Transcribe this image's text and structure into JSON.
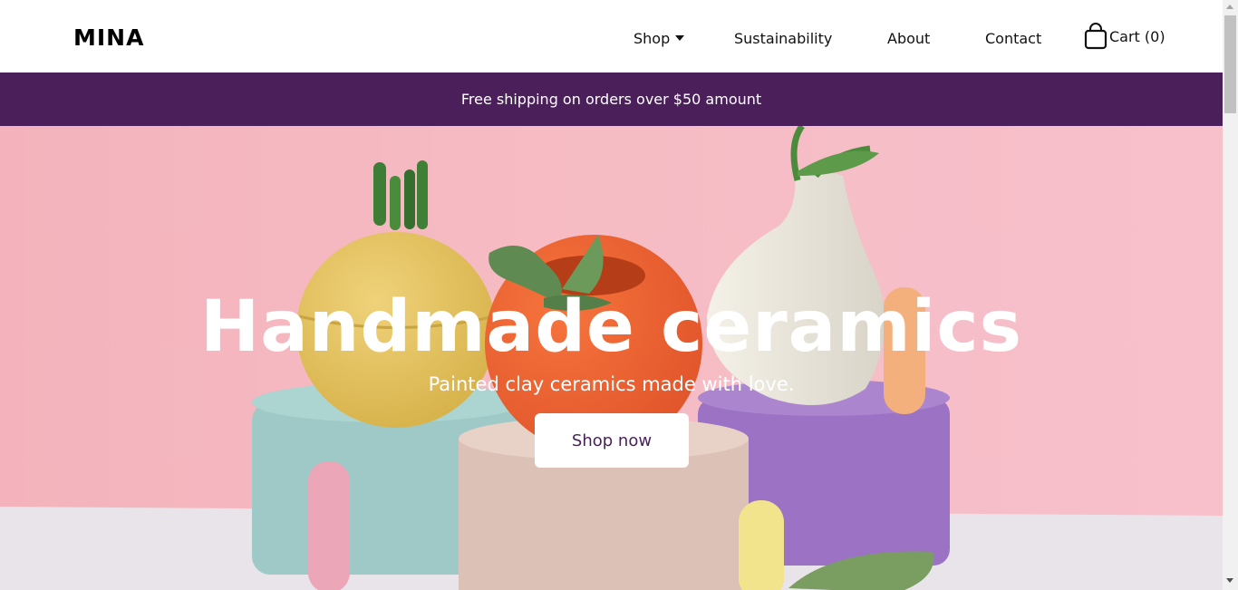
{
  "brand": {
    "logo": "MINA"
  },
  "nav": {
    "shop": "Shop",
    "sustainability": "Sustainability",
    "about": "About",
    "contact": "Contact",
    "cart": "Cart (0)"
  },
  "banner": {
    "text": "Free shipping on orders over $50 amount"
  },
  "hero": {
    "title": "Handmade ceramics",
    "subtitle": "Painted clay ceramics made with love.",
    "cta": "Shop now"
  },
  "colors": {
    "banner_bg": "#4a1f5a",
    "accent": "#4a1f5a",
    "hero_bg": "#f3b6c0"
  },
  "icons": {
    "cart": "shopping-bag-icon",
    "shop_dropdown": "caret-down-icon"
  }
}
